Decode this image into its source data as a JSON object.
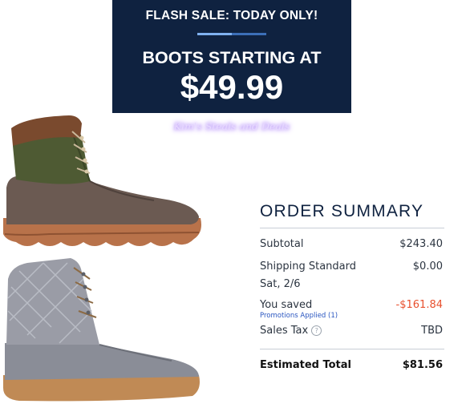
{
  "banner": {
    "flash_text": "FLASH SALE: TODAY ONLY!",
    "headline": "BOOTS STARTING AT",
    "price": "$49.99",
    "background_color": "#0f2240"
  },
  "watermark": {
    "text": "Kim's Steals and Deals"
  },
  "products": [
    {
      "name": "boot-green-leather",
      "colors": [
        "#4e5a33",
        "#6b5a52",
        "#b8724a"
      ]
    },
    {
      "name": "boot-grey-quilted",
      "colors": [
        "#8a8d97",
        "#c08a55"
      ]
    }
  ],
  "order_summary": {
    "title": "ORDER SUMMARY",
    "subtotal_label": "Subtotal",
    "subtotal_value": "$243.40",
    "shipping_label": "Shipping Standard",
    "shipping_date": "Sat, 2/6",
    "shipping_value": "$0.00",
    "saved_label": "You saved",
    "promotions_link": "Promotions Applied (1)",
    "saved_value": "-$161.84",
    "tax_label": "Sales Tax",
    "tax_value": "TBD",
    "total_label": "Estimated Total",
    "total_value": "$81.56",
    "saved_color": "#e8502e"
  }
}
